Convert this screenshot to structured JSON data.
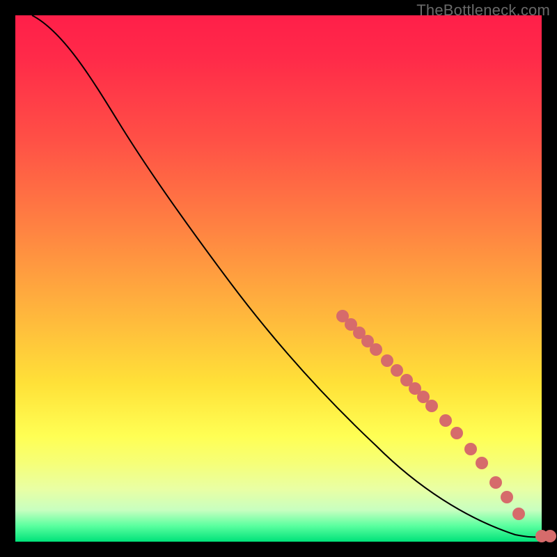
{
  "watermark": {
    "text": "TheBottleneck.com"
  },
  "colors": {
    "dot": "#d66b6b",
    "curve": "#000000",
    "background": "#000000"
  },
  "chart_data": {
    "type": "line",
    "title": "",
    "xlabel": "",
    "ylabel": "",
    "xlim": [
      0,
      100
    ],
    "ylim": [
      0,
      100
    ],
    "series": [
      {
        "name": "curve",
        "x": [
          0,
          10,
          20,
          30,
          40,
          50,
          60,
          70,
          80,
          90,
          100
        ],
        "y": [
          100,
          94,
          84,
          73,
          62,
          51,
          41,
          30,
          19,
          9,
          1
        ]
      }
    ],
    "markers": {
      "name": "highlighted-points",
      "x": [
        62,
        64,
        66,
        68,
        70,
        72,
        74,
        76,
        78,
        80,
        82,
        84,
        86,
        90,
        92,
        94,
        97,
        100
      ],
      "y": [
        38,
        36,
        34,
        32,
        30,
        28,
        26,
        24,
        22,
        20,
        18,
        16,
        14,
        10,
        8,
        6,
        3,
        1
      ]
    },
    "grid": false,
    "legend": false
  }
}
